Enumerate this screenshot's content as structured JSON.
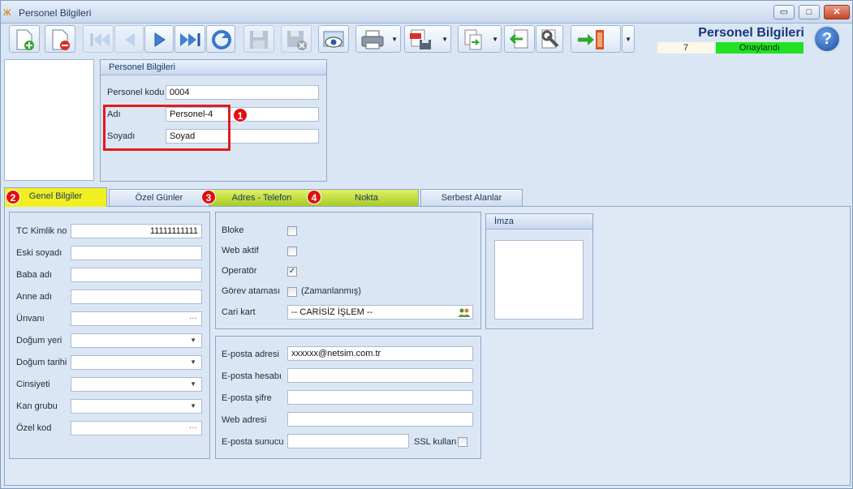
{
  "window": {
    "title": "Personel Bilgileri",
    "controls": {
      "minimize": "▭",
      "maximize": "□",
      "close": "✕"
    }
  },
  "header": {
    "title": "Personel Bilgileri",
    "count": "7",
    "status": "Onaylandı",
    "status_color": "#22e022"
  },
  "top_group": {
    "title": "Personel Bilgileri",
    "fields": [
      {
        "label": "Personel kodu",
        "value": "0004"
      },
      {
        "label": "Adı",
        "value": "Personel-4"
      },
      {
        "label": "Soyadı",
        "value": "Soyad"
      }
    ]
  },
  "badges": [
    "1",
    "2",
    "3",
    "4"
  ],
  "tabs": [
    {
      "label": "Genel Bilgiler"
    },
    {
      "label": "Özel Günler"
    },
    {
      "label": "Adres - Telefon"
    },
    {
      "label": "Nokta"
    },
    {
      "label": "Serbest Alanlar"
    }
  ],
  "general": {
    "fields": [
      {
        "label": "TC Kimlik no",
        "value": "11111111111"
      },
      {
        "label": "Eski soyadı",
        "value": ""
      },
      {
        "label": "Baba adı",
        "value": ""
      },
      {
        "label": "Anne adı",
        "value": ""
      },
      {
        "label": "Ünvanı",
        "value": ""
      },
      {
        "label": "Doğum yeri",
        "value": ""
      },
      {
        "label": "Doğum tarihi",
        "value": ""
      },
      {
        "label": "Cinsiyeti",
        "value": ""
      },
      {
        "label": "Kan grubu",
        "value": ""
      },
      {
        "label": "Özel kod",
        "value": ""
      }
    ]
  },
  "flags": {
    "bloke": {
      "label": "Bloke",
      "checked": false
    },
    "web_aktif": {
      "label": "Web aktif",
      "checked": false
    },
    "operator": {
      "label": "Operatör",
      "checked": true
    },
    "gorev": {
      "label": "Görev ataması",
      "checked": false,
      "note": "(Zamanlanmış)"
    },
    "cari": {
      "label": "Cari kart",
      "value": "-- CARİSİZ İŞLEM --"
    }
  },
  "email": {
    "fields": [
      {
        "label": "E-posta adresi",
        "value": "xxxxxx@netsim.com.tr"
      },
      {
        "label": "E-posta hesabı",
        "value": ""
      },
      {
        "label": "E-posta şifre",
        "value": ""
      },
      {
        "label": "Web adresi",
        "value": ""
      },
      {
        "label": "E-posta sunucu",
        "value": ""
      }
    ],
    "ssl_label": "SSL kullan",
    "ssl_checked": false
  },
  "imza": {
    "title": "İmza"
  },
  "glyphs": {
    "check": "✓",
    "dropdown": "▼",
    "ellipsis": "···",
    "help": "?",
    "app_icon": "ж"
  },
  "colors": {
    "accent": "#15397b",
    "highlight_tab": "#f1ef22",
    "green_tab": "#b5d430",
    "badge": "#e01010"
  }
}
